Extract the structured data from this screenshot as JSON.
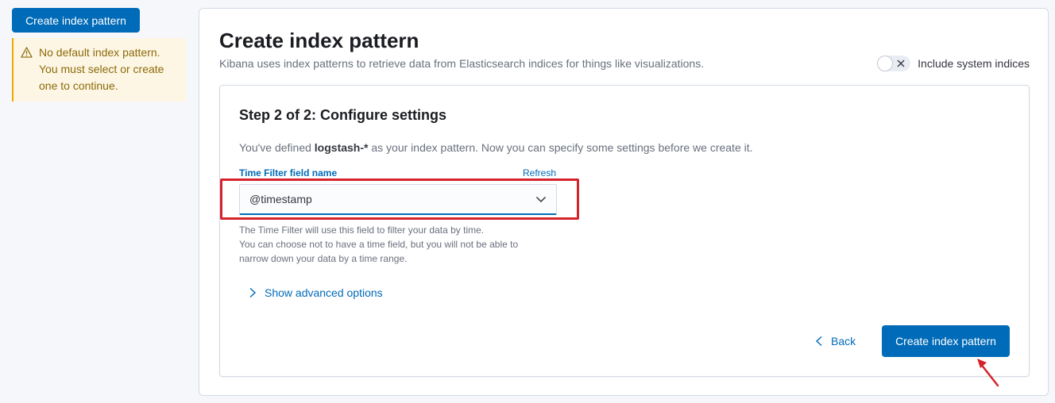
{
  "sidebar": {
    "create_button": "Create index pattern",
    "callout": {
      "line1": "No default index pattern.",
      "line2": "You must select or create",
      "line3": "one to continue."
    }
  },
  "header": {
    "title": "Create index pattern",
    "subtitle": "Kibana uses index patterns to retrieve data from Elasticsearch indices for things like visualizations.",
    "toggle_label": "Include system indices",
    "toggle_on": false
  },
  "step": {
    "title": "Step 2 of 2: Configure settings",
    "desc_prefix": "You've defined ",
    "pattern": "logstash-*",
    "desc_suffix": " as your index pattern. Now you can specify some settings before we create it.",
    "field_label": "Time Filter field name",
    "refresh": "Refresh",
    "select_value": "@timestamp",
    "help": [
      "The Time Filter will use this field to filter your data by time.",
      "You can choose not to have a time field, but you will not be able to",
      "narrow down your data by a time range."
    ],
    "advanced": "Show advanced options",
    "back": "Back",
    "submit": "Create index pattern"
  },
  "colors": {
    "primary": "#006bb8",
    "warning_bg": "#fef6e4",
    "highlight": "#d6232b"
  }
}
